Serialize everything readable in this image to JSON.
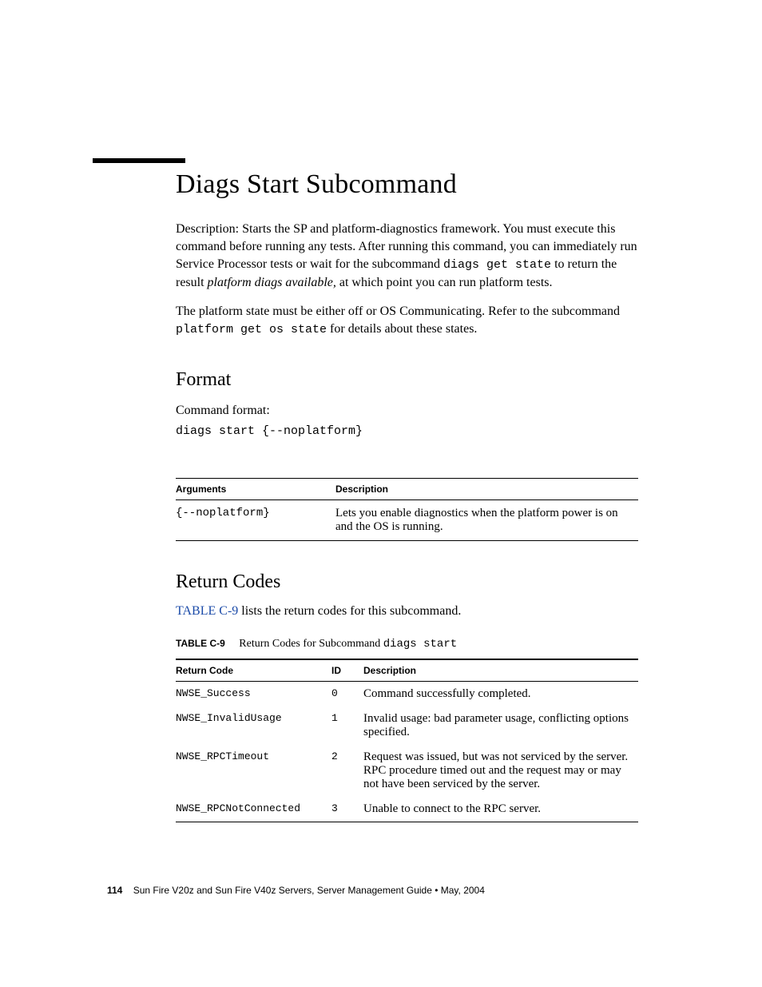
{
  "title": "Diags Start Subcommand",
  "desc": {
    "p1_a": "Description: Starts the SP and platform-diagnostics framework. You must execute this command before running any tests. After running this command, you can immediately run Service Processor tests or wait for the subcommand ",
    "p1_cmd": "diags get state",
    "p1_b": " to return the result ",
    "p1_ital": "platform diags available,",
    "p1_c": " at which point you can run platform tests.",
    "p2_a": "The platform state must be either off or OS Communicating. Refer to the subcommand ",
    "p2_cmd": "platform get os state",
    "p2_b": " for details about these states."
  },
  "format": {
    "heading": "Format",
    "label": "Command format:",
    "command": "diags start {--noplatform}"
  },
  "args_table": {
    "head_arg": "Arguments",
    "head_desc": "Description",
    "rows": [
      {
        "arg": "{--noplatform}",
        "desc": "Lets you enable diagnostics when the platform power is on and the OS is running."
      }
    ]
  },
  "return_codes": {
    "heading": "Return Codes",
    "intro_link": "TABLE C-9",
    "intro_rest": " lists the return codes for this subcommand.",
    "caption_label": "TABLE C-9",
    "caption_text": "Return Codes for Subcommand ",
    "caption_cmd": "diags start",
    "head_code": "Return Code",
    "head_id": "ID",
    "head_desc": "Description",
    "rows": [
      {
        "code": "NWSE_Success",
        "id": "0",
        "desc": "Command successfully completed."
      },
      {
        "code": "NWSE_InvalidUsage",
        "id": "1",
        "desc": "Invalid usage: bad parameter usage, conflicting options specified."
      },
      {
        "code": "NWSE_RPCTimeout",
        "id": "2",
        "desc": "Request was issued, but was not serviced by the server. RPC procedure timed out and the request may or may not have been serviced by the server."
      },
      {
        "code": "NWSE_RPCNotConnected",
        "id": "3",
        "desc": "Unable to connect to the RPC server."
      }
    ]
  },
  "footer": {
    "page": "114",
    "text": "Sun Fire V20z and Sun Fire V40z Servers, Server Management Guide • May, 2004"
  }
}
